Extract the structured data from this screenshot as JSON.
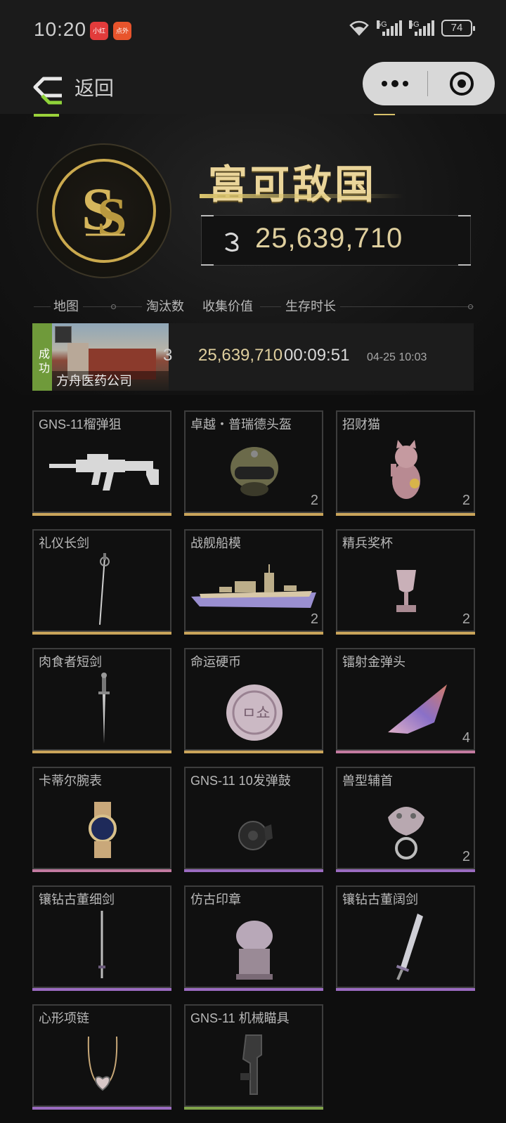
{
  "status_bar": {
    "time": "10:20",
    "badge1": "小红书",
    "badge2": "点外卖",
    "sig1": "5G",
    "sig2": "5G",
    "battery": "74"
  },
  "nav": {
    "back_label": "返回"
  },
  "hero": {
    "title": "富可敌国",
    "value": "25,639,710"
  },
  "table_headers": {
    "map": "地图",
    "kills": "淘汰数",
    "value": "收集价值",
    "survival": "生存时长"
  },
  "record": {
    "status": "成功",
    "map_name": "方舟医药公司",
    "kills": "3",
    "value": "25,639,710",
    "survival": "00:09:51",
    "date": "04-25 10:03"
  },
  "colors": {
    "gold_bar": "#c9a45a",
    "pink_bar": "#c27aa0",
    "purple_bar": "#9a6bc0",
    "green_bar": "#7fa24a"
  },
  "items": [
    {
      "name": "GNS-11榴弹狙",
      "count": "",
      "icon": "rifle-icon",
      "tier": "gold"
    },
    {
      "name": "卓越・普瑞德头盔",
      "count": "2",
      "icon": "helmet-icon",
      "tier": "gold"
    },
    {
      "name": "招财猫",
      "count": "2",
      "icon": "lucky-cat-icon",
      "tier": "gold"
    },
    {
      "name": "礼仪长剑",
      "count": "",
      "icon": "rapier-icon",
      "tier": "gold"
    },
    {
      "name": "战舰船模",
      "count": "2",
      "icon": "warship-model-icon",
      "tier": "gold"
    },
    {
      "name": "精兵奖杯",
      "count": "2",
      "icon": "trophy-icon",
      "tier": "gold"
    },
    {
      "name": "肉食者短剑",
      "count": "",
      "icon": "dagger-icon",
      "tier": "gold"
    },
    {
      "name": "命运硬币",
      "count": "",
      "icon": "coin-icon",
      "tier": "gold"
    },
    {
      "name": "镭射金弹头",
      "count": "4",
      "icon": "bullet-tip-icon",
      "tier": "pink"
    },
    {
      "name": "卡蒂尔腕表",
      "count": "",
      "icon": "watch-icon",
      "tier": "pink"
    },
    {
      "name": "GNS-11 10发弹鼓",
      "count": "",
      "icon": "drum-magazine-icon",
      "tier": "purple"
    },
    {
      "name": "兽型辅首",
      "count": "2",
      "icon": "door-knocker-icon",
      "tier": "purple"
    },
    {
      "name": "镶钻古董细剑",
      "count": "",
      "icon": "thin-sword-icon",
      "tier": "purple"
    },
    {
      "name": "仿古印章",
      "count": "",
      "icon": "seal-icon",
      "tier": "purple"
    },
    {
      "name": "镶钻古董阔剑",
      "count": "",
      "icon": "broadsword-icon",
      "tier": "purple"
    },
    {
      "name": "心形项链",
      "count": "",
      "icon": "heart-necklace-icon",
      "tier": "purple"
    },
    {
      "name": "GNS-11 机械瞄具",
      "count": "",
      "icon": "iron-sight-icon",
      "tier": "green"
    }
  ]
}
